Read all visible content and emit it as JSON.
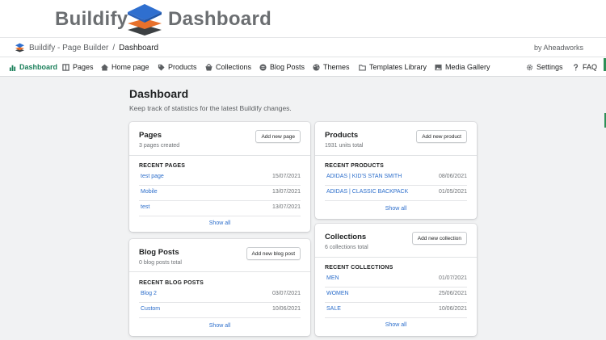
{
  "banner": {
    "left_word": "Buildify",
    "right_word": "Dashboard"
  },
  "breadcrumb": {
    "app": "Buildify - Page Builder",
    "separator": "/",
    "current": "Dashboard"
  },
  "vendor": "by Aheadworks",
  "nav": {
    "items": [
      {
        "label": "Dashboard",
        "icon": "bar-chart-icon"
      },
      {
        "label": "Pages",
        "icon": "pages-icon"
      },
      {
        "label": "Home page",
        "icon": "home-icon"
      },
      {
        "label": "Products",
        "icon": "tag-icon"
      },
      {
        "label": "Collections",
        "icon": "basket-icon"
      },
      {
        "label": "Blog Posts",
        "icon": "blog-icon"
      },
      {
        "label": "Themes",
        "icon": "palette-icon"
      },
      {
        "label": "Templates Library",
        "icon": "folder-icon"
      },
      {
        "label": "Media Gallery",
        "icon": "image-icon"
      },
      {
        "label": "Settings",
        "icon": "gear-icon"
      },
      {
        "label": "FAQ",
        "icon": "question-icon"
      }
    ]
  },
  "page": {
    "title": "Dashboard",
    "subtitle": "Keep track of statistics for the latest Buildify changes."
  },
  "cards": {
    "pages": {
      "title": "Pages",
      "subtitle": "3 pages created",
      "button": "Add new page",
      "section": "RECENT PAGES",
      "rows": [
        {
          "name": "test page",
          "date": "15/07/2021"
        },
        {
          "name": "Mobile",
          "date": "13/07/2021"
        },
        {
          "name": "test",
          "date": "13/07/2021"
        }
      ],
      "show_all": "Show all"
    },
    "blog": {
      "title": "Blog Posts",
      "subtitle": "0 blog posts total",
      "button": "Add new blog post",
      "section": "RECENT BLOG POSTS",
      "rows": [
        {
          "name": "Blog 2",
          "date": "03/07/2021"
        },
        {
          "name": "Custom",
          "date": "10/06/2021"
        }
      ],
      "show_all": "Show all"
    },
    "products": {
      "title": "Products",
      "subtitle": "1931 units total",
      "button": "Add new product",
      "section": "RECENT PRODUCTS",
      "rows": [
        {
          "name": "ADIDAS | KID'S STAN SMITH",
          "date": "08/06/2021"
        },
        {
          "name": "ADIDAS | CLASSIC BACKPACK",
          "date": "01/05/2021"
        }
      ],
      "show_all": "Show all"
    },
    "collections": {
      "title": "Collections",
      "subtitle": "6 collections total",
      "button": "Add new collection",
      "section": "RECENT COLLECTIONS",
      "rows": [
        {
          "name": "MEN",
          "date": "01/07/2021"
        },
        {
          "name": "WOMEN",
          "date": "25/06/2021"
        },
        {
          "name": "SALE",
          "date": "10/06/2021"
        }
      ],
      "show_all": "Show all"
    }
  },
  "colors": {
    "accent": "#1a7f5a",
    "link": "#2c6ecb",
    "logo_blue": "#2f6fcf",
    "logo_orange": "#e8712c",
    "logo_dark": "#3c4043"
  }
}
